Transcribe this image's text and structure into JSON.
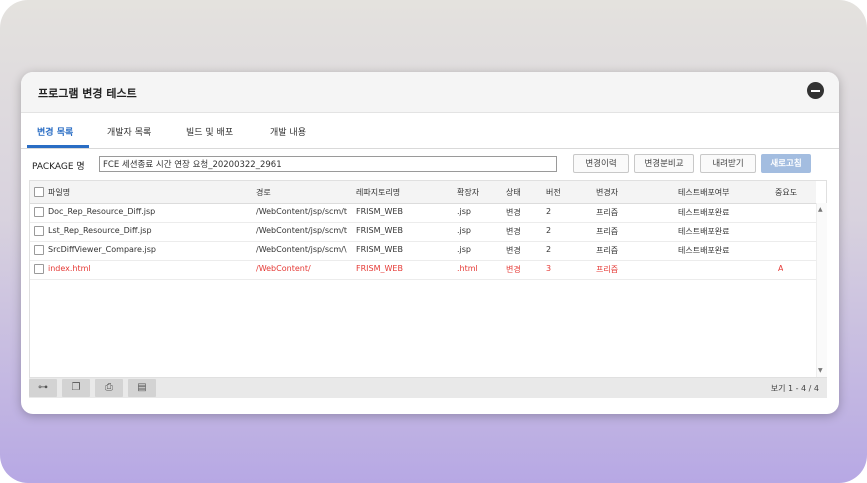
{
  "window": {
    "title": "프로그램 변경 테스트"
  },
  "tabs": [
    {
      "label": "변경 목록",
      "active": true
    },
    {
      "label": "개발자 목록",
      "active": false
    },
    {
      "label": "빌드 및 배포",
      "active": false
    },
    {
      "label": "개발 내용",
      "active": false
    }
  ],
  "package": {
    "label": "PACKAGE 명",
    "value": "FCE 세션종료 시간 연장 요청_20200322_2961"
  },
  "buttons": {
    "history": "변경이력",
    "compare": "변경분비교",
    "download": "내려받기",
    "refresh": "새로고침"
  },
  "table": {
    "headers": [
      "파일명",
      "경로",
      "레파지토리명",
      "확장자",
      "상태",
      "버전",
      "변경자",
      "테스트배포여부",
      "중요도"
    ],
    "rows": [
      {
        "cells": [
          "Doc_Rep_Resource_Diff.jsp",
          "/WebContent/jsp/scm/t",
          "FRISM_WEB",
          ".jsp",
          "변경",
          "2",
          "프리즘",
          "테스트배포완료",
          ""
        ],
        "highlight": false
      },
      {
        "cells": [
          "Lst_Rep_Resource_Diff.jsp",
          "/WebContent/jsp/scm/t",
          "FRISM_WEB",
          ".jsp",
          "변경",
          "2",
          "프리즘",
          "테스트배포완료",
          ""
        ],
        "highlight": false
      },
      {
        "cells": [
          "SrcDiffViewer_Compare.jsp",
          "/WebContent/jsp/scm/\\",
          "FRISM_WEB",
          ".jsp",
          "변경",
          "2",
          "프리즘",
          "테스트배포완료",
          ""
        ],
        "highlight": false
      },
      {
        "cells": [
          "index.html",
          "/WebContent/",
          "FRISM_WEB",
          ".html",
          "변경",
          "3",
          "프리즘",
          "",
          "A"
        ],
        "highlight": true
      }
    ]
  },
  "footer": {
    "pager": "보기 1 - 4 / 4"
  },
  "icons": {
    "footer": [
      "tree-icon",
      "copy-icon",
      "print-icon",
      "save-icon"
    ]
  },
  "colors": {
    "accent": "#2a6dc4",
    "highlight_row": "#e53935",
    "primary_button": "#a3bde0"
  }
}
